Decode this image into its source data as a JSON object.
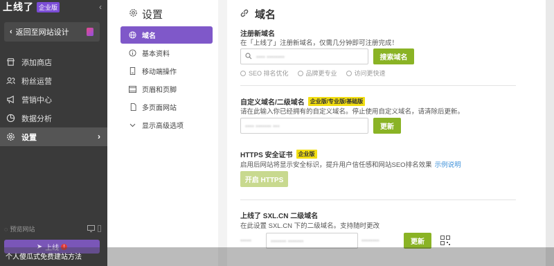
{
  "sidebar": {
    "brand": "上线了",
    "brand_badge": "企业版",
    "back_label": "返回至网站设计",
    "items": [
      {
        "label": "添加商店",
        "icon": "store-icon"
      },
      {
        "label": "粉丝运营",
        "icon": "fans-icon"
      },
      {
        "label": "营销中心",
        "icon": "megaphone-icon"
      },
      {
        "label": "数据分析",
        "icon": "chart-icon"
      },
      {
        "label": "设置",
        "icon": "gear-icon",
        "active": true
      }
    ],
    "preview_label": "预览网站",
    "publish_label": "上线",
    "caption": "个人傻瓜式免费建站方法"
  },
  "menu": {
    "title": "设置",
    "items": [
      {
        "label": "域名",
        "icon": "globe-icon",
        "active": true
      },
      {
        "label": "基本资料",
        "icon": "info-icon"
      },
      {
        "label": "移动端操作",
        "icon": "mobile-icon"
      },
      {
        "label": "页眉和页脚",
        "icon": "header-footer-icon"
      },
      {
        "label": "多页面网站",
        "icon": "pages-icon"
      },
      {
        "label": "显示高级选项",
        "icon": "chevron-down-icon"
      }
    ]
  },
  "main": {
    "title": "域名",
    "register": {
      "heading": "注册新域名",
      "desc": "在「上线了」注册新域名，仅需几分钟即可注册完成！",
      "input_placeholder": "",
      "button": "搜索域名",
      "features": [
        "SEO 排名优化",
        "品牌更专业",
        "访问更快速"
      ]
    },
    "custom": {
      "heading": "自定义域名/二级域名",
      "badge": "企业版/专业版/基础版",
      "desc": "请在此输入你已经拥有的自定义域名。停止使用自定义域名，请清除后更新。",
      "button": "更新"
    },
    "https": {
      "heading": "HTTPS 安全证书",
      "badge": "企业版",
      "desc": "启用后网站将显示安全标识，提升用户信任感和网站SEO排名效果",
      "link": "示例说明",
      "button": "开启 HTTPS"
    },
    "sxl": {
      "heading": "上线了 SXL.CN 二级域名",
      "desc": "在此设置 SXL.CN 下的二级域名。支持随时更改",
      "button": "更新"
    }
  },
  "colors": {
    "sidebar_bg": "#3a3a3a",
    "accent_purple": "#7f58c9",
    "button_green": "#8ab325",
    "badge_yellow": "#f2de12"
  }
}
